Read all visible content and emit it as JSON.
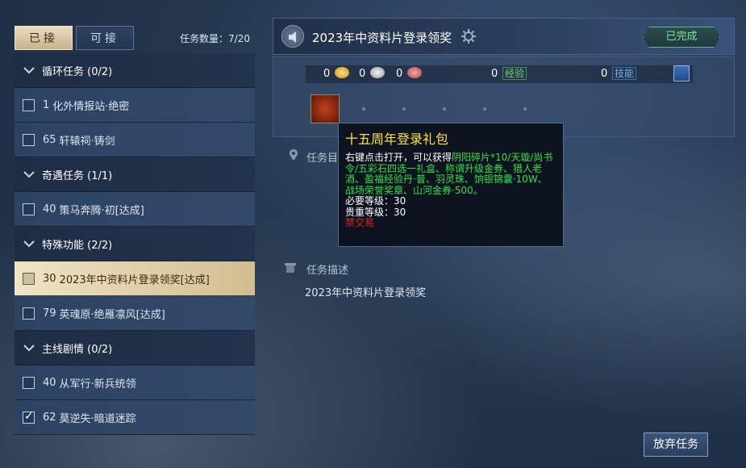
{
  "left": {
    "tabs": [
      {
        "label": "已接"
      },
      {
        "label": "可接"
      }
    ],
    "task_count": "任务数量：7/20",
    "categories": [
      {
        "label": "循环任务 (0/2)"
      },
      {
        "label": "奇遇任务 (1/1)"
      },
      {
        "label": "特殊功能 (2/2)"
      },
      {
        "label": "主线剧情 (0/2)"
      }
    ],
    "tasks": [
      {
        "level": "1",
        "name": "化外情报站·绝密",
        "checked": false
      },
      {
        "level": "65",
        "name": "轩辕祠·铸剑",
        "checked": false
      },
      {
        "level": "40",
        "name": "策马奔腾·初[达成]",
        "checked": false
      },
      {
        "level": "30",
        "name": "2023年中资料片登录领奖[达成]",
        "checked": false
      },
      {
        "level": "79",
        "name": "英魂原·绝雁凛风[达成]",
        "checked": false
      },
      {
        "level": "40",
        "name": "从军行·新兵统领",
        "checked": false
      },
      {
        "level": "62",
        "name": "莫逆失·暗道迷踪",
        "checked": true
      }
    ]
  },
  "right": {
    "title": "2023年中资料片登录领奖",
    "status": "已完成",
    "rewards": {
      "gold": "0",
      "silver": "0",
      "copper": "0",
      "exp_value": "0",
      "exp_label": "经验",
      "skill_value": "0",
      "skill_label": "技能"
    },
    "target_label": "任务目",
    "desc_label": "任务描述",
    "desc_text": "2023年中资料片登录领奖",
    "abandon_label": "放弃任务"
  },
  "tooltip": {
    "title": "十五周年登录礼包",
    "text_prefix": "右键点击打开，可以获得",
    "text_green": "阴阳碎片*10/天璇/尚书令/五彩石四选一礼盒、称谓升级金券、猎人老酒、盈福经验丹·普、羽灵珠、饷银锦囊·10W、战场荣誉奖章、山河金券·500。",
    "req_level": "必要等级：30",
    "noble_level": "贵重等级：30",
    "no_trade": "禁交易"
  },
  "colors": {
    "selected_row": "#e6d7b3",
    "done_green": "#7fe2a0",
    "tooltip_title": "#ffe23a",
    "tooltip_green": "#2fe04a",
    "tooltip_red": "#e02020"
  }
}
